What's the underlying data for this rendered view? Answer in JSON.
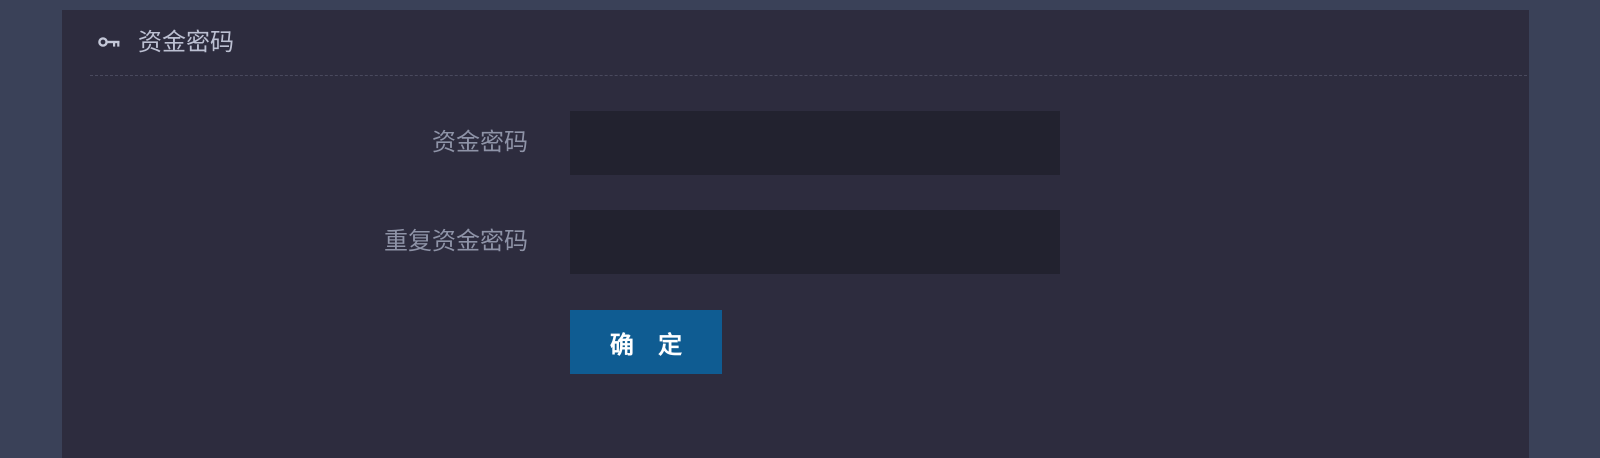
{
  "panel": {
    "title": "资金密码",
    "icon": "key-icon"
  },
  "form": {
    "fund_password": {
      "label": "资金密码",
      "value": ""
    },
    "repeat_fund_password": {
      "label": "重复资金密码",
      "value": ""
    },
    "confirm_label": "确 定"
  },
  "colors": {
    "page_background": "#3a4158",
    "panel_background": "#2d2c3e",
    "input_background": "#22222f",
    "button_background": "#0f5c92"
  }
}
